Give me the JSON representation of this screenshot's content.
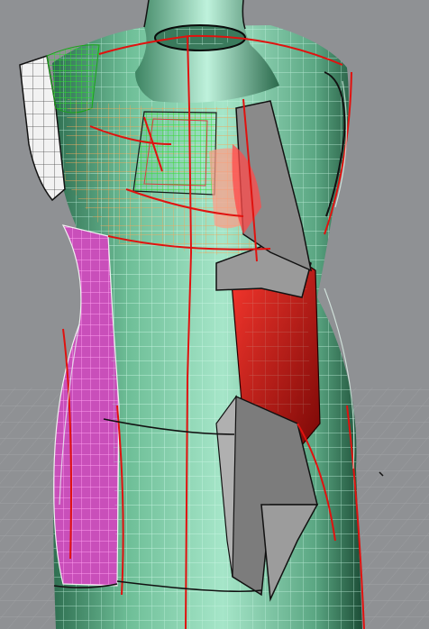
{
  "viewport": {
    "background_color": "#8f9194",
    "ground_grid_color": "#a3a5a8",
    "form_color": "#5fb08a",
    "form_highlight_color": "#9fe0c4",
    "form_shadow_color": "#1e5a3e",
    "mesh_color": "#b8f0d8",
    "seam_color": "#e0120f",
    "panel_pink_color": "#e060d0",
    "panel_green_color": "#22d022",
    "panel_orange_color": "#f0a050",
    "panel_white_color": "#e6e6e6",
    "drape_red_color": "#c41010",
    "drape_grey_color": "#8a8a8a"
  }
}
